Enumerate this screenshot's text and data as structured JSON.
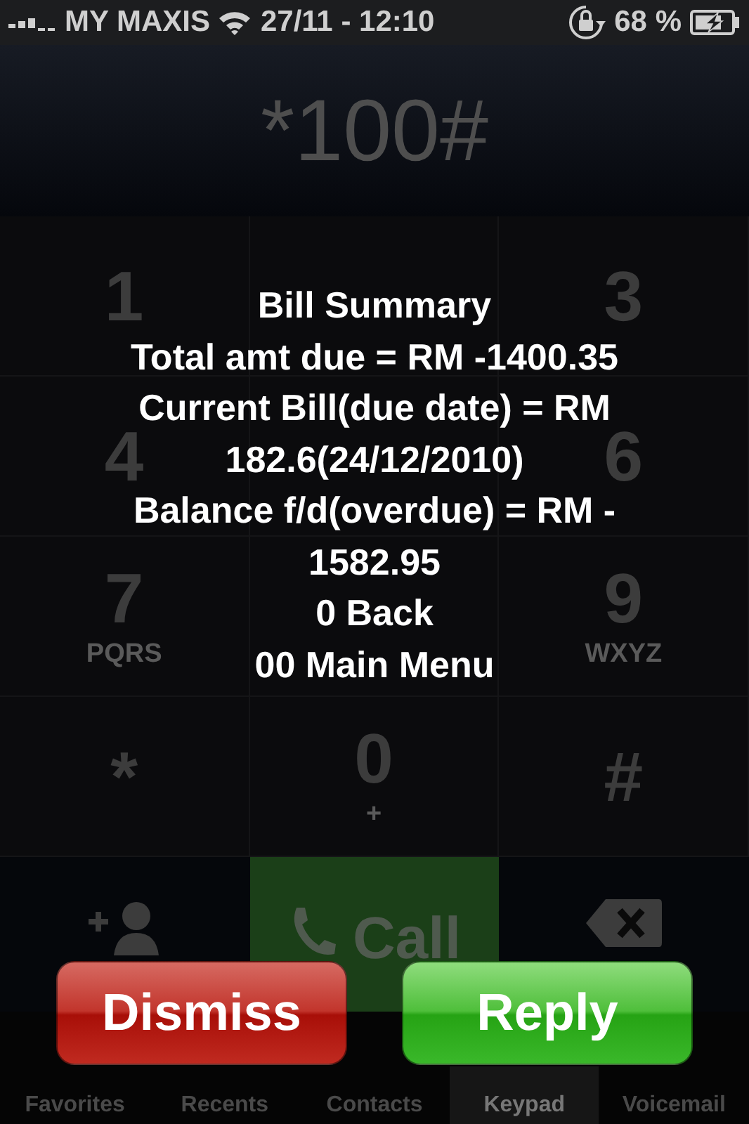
{
  "status_bar": {
    "carrier": "MY MAXIS",
    "datetime": "27/11 - 12:10",
    "battery": "68 %",
    "charging": true
  },
  "display": {
    "number": "*100#"
  },
  "keypad_rows": [
    {
      "left": {
        "digit": "1"
      },
      "right": {
        "digit": "3"
      }
    },
    {
      "left": {
        "digit": "4"
      },
      "right": {
        "digit": "6"
      }
    },
    {
      "left": {
        "digit": "7",
        "letters": "PQRS"
      },
      "right": {
        "digit": "9",
        "letters": "WXYZ"
      }
    },
    {
      "left": {
        "digit": "*"
      },
      "center": {
        "digit": "0",
        "letters": "+"
      },
      "right": {
        "digit": "#"
      }
    }
  ],
  "call_button": {
    "label": "Call"
  },
  "ussd_dialog": {
    "title": "Bill Summary",
    "lines": [
      "Total amt due = RM -1400.35",
      "Current Bill(due date) = RM",
      "182.6(24/12/2010)",
      "Balance f/d(overdue) = RM -",
      "1582.95",
      "0 Back",
      "00 Main Menu"
    ],
    "buttons": [
      {
        "label": "Dismiss",
        "kind": "cancel"
      },
      {
        "label": "Reply",
        "kind": "confirm"
      }
    ]
  },
  "tabs": [
    {
      "label": "Favorites",
      "selected": false
    },
    {
      "label": "Recents",
      "selected": false
    },
    {
      "label": "Contacts",
      "selected": false
    },
    {
      "label": "Keypad",
      "selected": true
    },
    {
      "label": "Voicemail",
      "selected": false
    }
  ]
}
